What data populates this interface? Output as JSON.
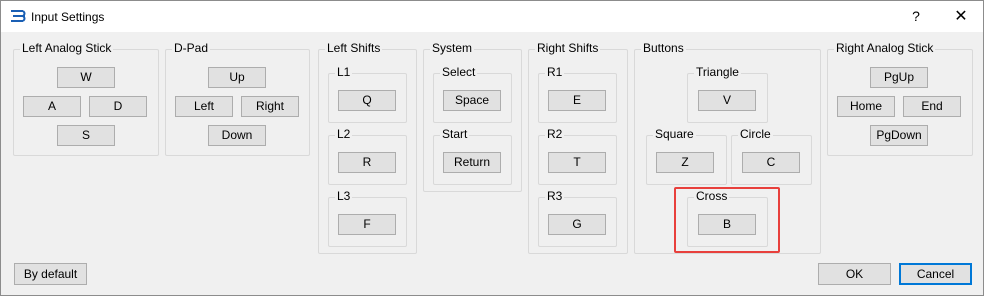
{
  "window": {
    "title": "Input Settings",
    "help": "?",
    "close": "✕"
  },
  "groups": {
    "left_analog": {
      "title": "Left Analog Stick",
      "up": "W",
      "left": "A",
      "right": "D",
      "down": "S"
    },
    "dpad": {
      "title": "D-Pad",
      "up": "Up",
      "left": "Left",
      "right": "Right",
      "down": "Down"
    },
    "left_shifts": {
      "title": "Left Shifts",
      "l1": {
        "title": "L1",
        "key": "Q"
      },
      "l2": {
        "title": "L2",
        "key": "R"
      },
      "l3": {
        "title": "L3",
        "key": "F"
      }
    },
    "system": {
      "title": "System",
      "select": {
        "title": "Select",
        "key": "Space"
      },
      "start": {
        "title": "Start",
        "key": "Return"
      }
    },
    "right_shifts": {
      "title": "Right Shifts",
      "r1": {
        "title": "R1",
        "key": "E"
      },
      "r2": {
        "title": "R2",
        "key": "T"
      },
      "r3": {
        "title": "R3",
        "key": "G"
      }
    },
    "buttons": {
      "title": "Buttons",
      "triangle": {
        "title": "Triangle",
        "key": "V"
      },
      "square": {
        "title": "Square",
        "key": "Z"
      },
      "circle": {
        "title": "Circle",
        "key": "C"
      },
      "cross": {
        "title": "Cross",
        "key": "B"
      }
    },
    "right_analog": {
      "title": "Right Analog Stick",
      "up": "PgUp",
      "left": "Home",
      "right": "End",
      "down": "PgDown"
    }
  },
  "footer": {
    "default": "By default",
    "ok": "OK",
    "cancel": "Cancel"
  },
  "colors": {
    "highlight": "#e8403c",
    "accent": "#0078d7"
  }
}
